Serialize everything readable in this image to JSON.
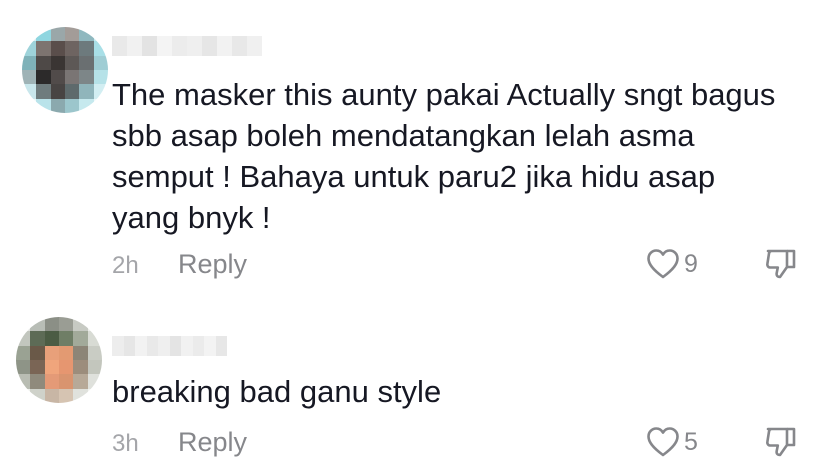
{
  "comments": [
    {
      "text": "The masker this aunty pakai Actually sngt bagus\nsbb asap boleh mendatangkan lelah asma\nsemput ! Bahaya untuk paru2 jika hidu asap\nyang bnyk !",
      "time": "2h",
      "reply_label": "Reply",
      "like_count": "9",
      "avatar_pixels": [
        "#d9eef1",
        "#8fd6e0",
        "#9aa7a9",
        "#a39c98",
        "#8fb8bf",
        "#c5e9ef",
        "#9ed3da",
        "#7d7470",
        "#5a4e4b",
        "#6e6461",
        "#6d7a7d",
        "#a8dfe7",
        "#7fb2b9",
        "#4e4947",
        "#3a3533",
        "#5d5856",
        "#6a6f71",
        "#9fcdd4",
        "#9fb3b6",
        "#2c2a2a",
        "#514b4a",
        "#7a7574",
        "#7d8688",
        "#b6e2e8",
        "#c9e7ec",
        "#6f7c7e",
        "#484443",
        "#5e6a6c",
        "#90b5bb",
        "#d2eef2",
        "#eef8fa",
        "#b9e3ea",
        "#8ba9ae",
        "#9cc6cc",
        "#c6e9ee",
        "#eef8fa"
      ],
      "username_blocks": [
        "#e9e9e9",
        "#f1f1f1",
        "#e3e3e3",
        "#f4f4f4",
        "#ececec",
        "#efefef",
        "#e6e6e6",
        "#f2f2f2",
        "#e8e8e8",
        "#f0f0f0"
      ]
    },
    {
      "text": "breaking bad ganu style",
      "time": "3h",
      "reply_label": "Reply",
      "like_count": "5",
      "avatar_pixels": [
        "#e3e5e2",
        "#b8bdb6",
        "#8b8f86",
        "#9a9d94",
        "#c7cac3",
        "#eceeea",
        "#c2c6be",
        "#5d6b56",
        "#4b5c44",
        "#6f7e66",
        "#a2aa9a",
        "#d8dbd4",
        "#9aa293",
        "#6a5948",
        "#e8a07a",
        "#e39a72",
        "#8c8577",
        "#c9ccc4",
        "#8e9487",
        "#7a6555",
        "#f0a57c",
        "#e69670",
        "#9c8d7c",
        "#c3c6bd",
        "#b9bdb3",
        "#8f8a7c",
        "#e49a77",
        "#d9946f",
        "#b7a998",
        "#dfe1dc",
        "#eef0ec",
        "#cfd2ca",
        "#c8b6a5",
        "#d6c4b2",
        "#e0e2dd",
        "#f2f3f0"
      ],
      "username_blocks": [
        "#ededed",
        "#e6e6e6",
        "#f2f2f2",
        "#e9e9e9",
        "#efefef",
        "#e4e4e4",
        "#f1f1f1",
        "#ebebeb",
        "#f3f3f3",
        "#e7e7e7"
      ]
    }
  ],
  "icons": {
    "like": "heart-outline-icon",
    "dislike": "thumbs-down-outline-icon"
  },
  "colors": {
    "text": "#161823",
    "secondary": "#86878b",
    "time": "#a4a5a9"
  }
}
